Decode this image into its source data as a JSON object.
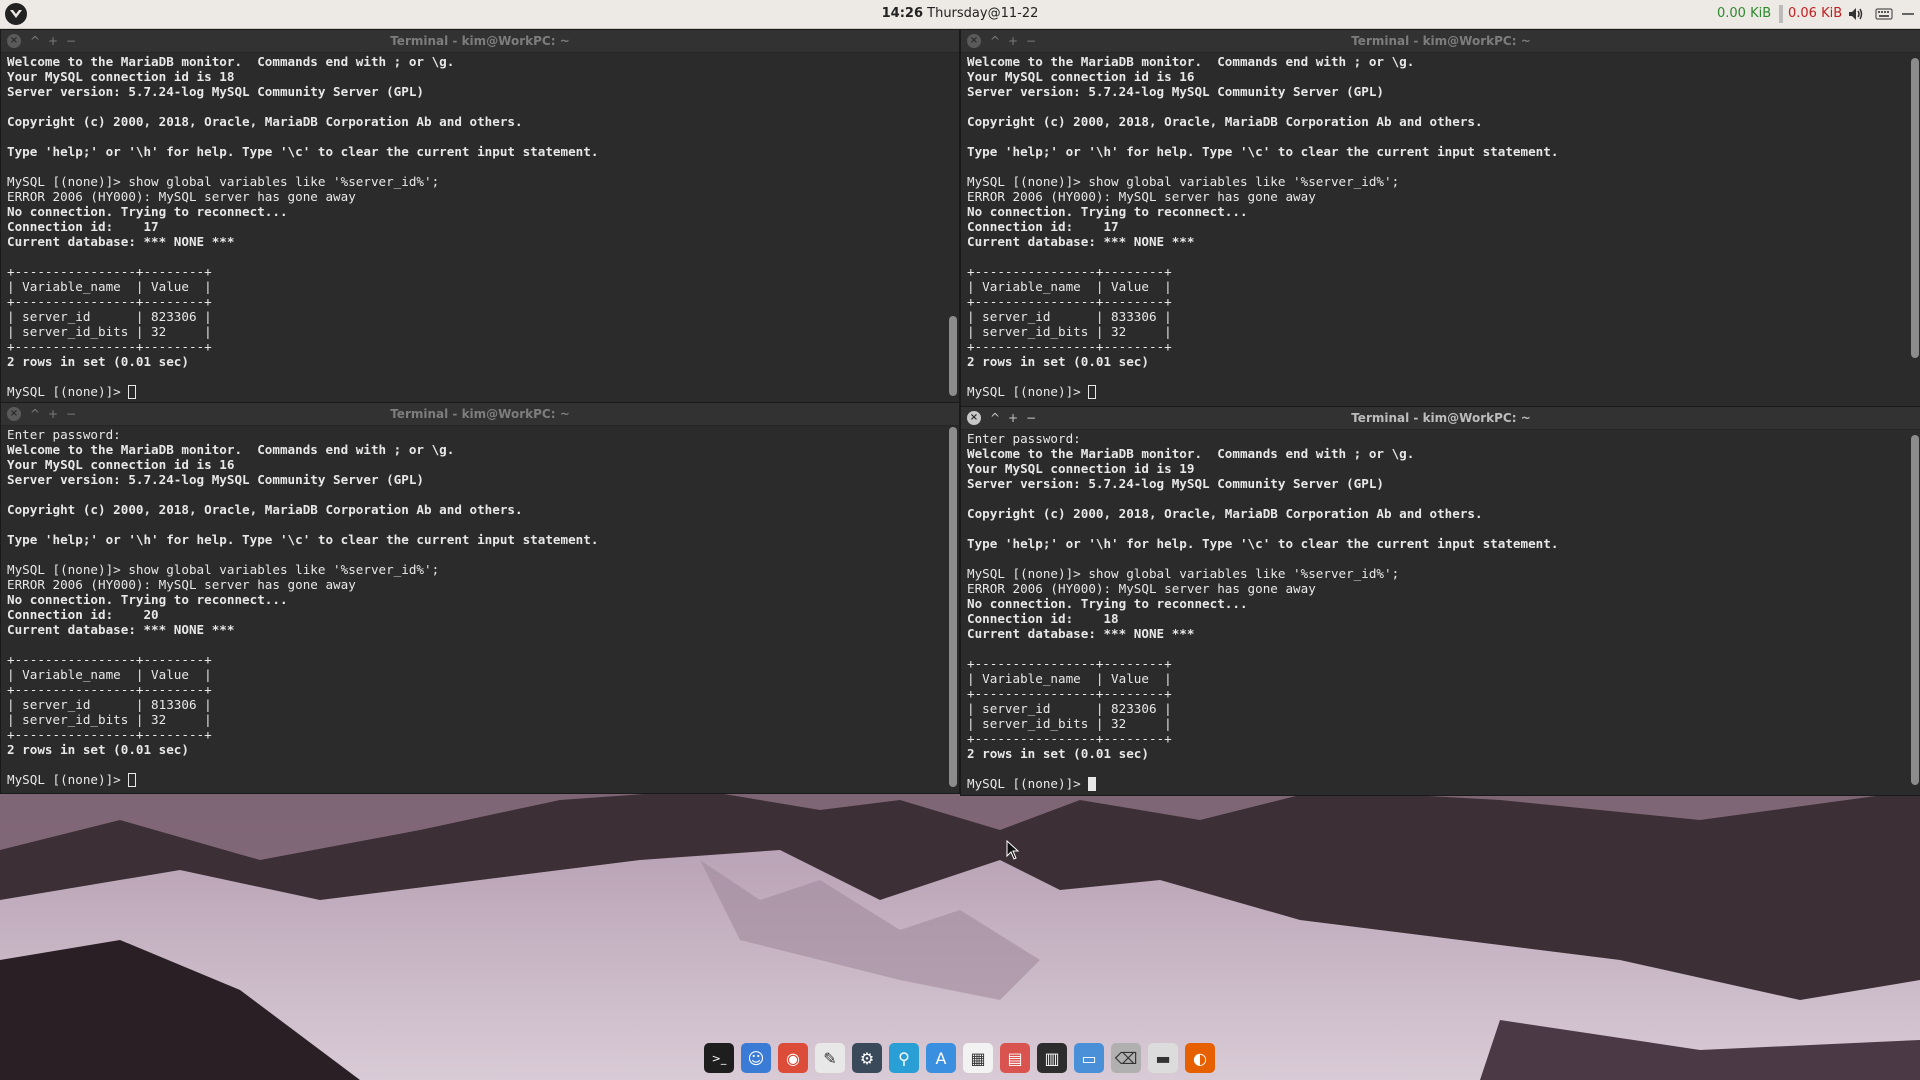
{
  "topbar": {
    "clock_time": "14:26",
    "clock_date": "Thursday@11-22",
    "net_down": "0.00 KiB",
    "net_up": "0.06 KiB",
    "icons": [
      "menu-logo-icon",
      "volume-icon",
      "keyboard-icon"
    ]
  },
  "terminals": [
    {
      "title": "Terminal - kim@WorkPC: ~",
      "active": false,
      "lines": [
        {
          "t": "Welcome to the MariaDB monitor.  Commands end with ; or \\g.",
          "b": true
        },
        {
          "t": "Your MySQL connection id is 18",
          "b": true
        },
        {
          "t": "Server version: 5.7.24-log MySQL Community Server (GPL)",
          "b": true
        },
        {
          "t": "",
          "b": false
        },
        {
          "t": "Copyright (c) 2000, 2018, Oracle, MariaDB Corporation Ab and others.",
          "b": true
        },
        {
          "t": "",
          "b": false
        },
        {
          "t": "Type 'help;' or '\\h' for help. Type '\\c' to clear the current input statement.",
          "b": true
        },
        {
          "t": "",
          "b": false
        },
        {
          "t": "MySQL [(none)]> show global variables like '%server_id%';",
          "b": false
        },
        {
          "t": "ERROR 2006 (HY000): MySQL server has gone away",
          "b": false
        },
        {
          "t": "No connection. Trying to reconnect...",
          "b": true
        },
        {
          "t": "Connection id:    17",
          "b": true
        },
        {
          "t": "Current database: *** NONE ***",
          "b": true
        },
        {
          "t": "",
          "b": false
        },
        {
          "t": "+----------------+--------+",
          "b": false
        },
        {
          "t": "| Variable_name  | Value  |",
          "b": false
        },
        {
          "t": "+----------------+--------+",
          "b": false
        },
        {
          "t": "| server_id      | 823306 |",
          "b": false
        },
        {
          "t": "| server_id_bits | 32     |",
          "b": false
        },
        {
          "t": "+----------------+--------+",
          "b": false
        },
        {
          "t": "2 rows in set (0.01 sec)",
          "b": true
        },
        {
          "t": "",
          "b": false
        }
      ],
      "prompt": "MySQL [(none)]> ",
      "cursor": "box"
    },
    {
      "title": "Terminal - kim@WorkPC: ~",
      "active": false,
      "lines": [
        {
          "t": "Welcome to the MariaDB monitor.  Commands end with ; or \\g.",
          "b": true
        },
        {
          "t": "Your MySQL connection id is 16",
          "b": true
        },
        {
          "t": "Server version: 5.7.24-log MySQL Community Server (GPL)",
          "b": true
        },
        {
          "t": "",
          "b": false
        },
        {
          "t": "Copyright (c) 2000, 2018, Oracle, MariaDB Corporation Ab and others.",
          "b": true
        },
        {
          "t": "",
          "b": false
        },
        {
          "t": "Type 'help;' or '\\h' for help. Type '\\c' to clear the current input statement.",
          "b": true
        },
        {
          "t": "",
          "b": false
        },
        {
          "t": "MySQL [(none)]> show global variables like '%server_id%';",
          "b": false
        },
        {
          "t": "ERROR 2006 (HY000): MySQL server has gone away",
          "b": false
        },
        {
          "t": "No connection. Trying to reconnect...",
          "b": true
        },
        {
          "t": "Connection id:    17",
          "b": true
        },
        {
          "t": "Current database: *** NONE ***",
          "b": true
        },
        {
          "t": "",
          "b": false
        },
        {
          "t": "+----------------+--------+",
          "b": false
        },
        {
          "t": "| Variable_name  | Value  |",
          "b": false
        },
        {
          "t": "+----------------+--------+",
          "b": false
        },
        {
          "t": "| server_id      | 833306 |",
          "b": false
        },
        {
          "t": "| server_id_bits | 32     |",
          "b": false
        },
        {
          "t": "+----------------+--------+",
          "b": false
        },
        {
          "t": "2 rows in set (0.01 sec)",
          "b": true
        },
        {
          "t": "",
          "b": false
        }
      ],
      "prompt": "MySQL [(none)]> ",
      "cursor": "box"
    },
    {
      "title": "Terminal - kim@WorkPC: ~",
      "active": false,
      "lines": [
        {
          "t": "Enter password:",
          "b": false
        },
        {
          "t": "Welcome to the MariaDB monitor.  Commands end with ; or \\g.",
          "b": true
        },
        {
          "t": "Your MySQL connection id is 16",
          "b": true
        },
        {
          "t": "Server version: 5.7.24-log MySQL Community Server (GPL)",
          "b": true
        },
        {
          "t": "",
          "b": false
        },
        {
          "t": "Copyright (c) 2000, 2018, Oracle, MariaDB Corporation Ab and others.",
          "b": true
        },
        {
          "t": "",
          "b": false
        },
        {
          "t": "Type 'help;' or '\\h' for help. Type '\\c' to clear the current input statement.",
          "b": true
        },
        {
          "t": "",
          "b": false
        },
        {
          "t": "MySQL [(none)]> show global variables like '%server_id%';",
          "b": false
        },
        {
          "t": "ERROR 2006 (HY000): MySQL server has gone away",
          "b": false
        },
        {
          "t": "No connection. Trying to reconnect...",
          "b": true
        },
        {
          "t": "Connection id:    20",
          "b": true
        },
        {
          "t": "Current database: *** NONE ***",
          "b": true
        },
        {
          "t": "",
          "b": false
        },
        {
          "t": "+----------------+--------+",
          "b": false
        },
        {
          "t": "| Variable_name  | Value  |",
          "b": false
        },
        {
          "t": "+----------------+--------+",
          "b": false
        },
        {
          "t": "| server_id      | 813306 |",
          "b": false
        },
        {
          "t": "| server_id_bits | 32     |",
          "b": false
        },
        {
          "t": "+----------------+--------+",
          "b": false
        },
        {
          "t": "2 rows in set (0.01 sec)",
          "b": true
        },
        {
          "t": "",
          "b": false
        }
      ],
      "prompt": "MySQL [(none)]> ",
      "cursor": "box"
    },
    {
      "title": "Terminal - kim@WorkPC: ~",
      "active": true,
      "lines": [
        {
          "t": "Enter password:",
          "b": false
        },
        {
          "t": "Welcome to the MariaDB monitor.  Commands end with ; or \\g.",
          "b": true
        },
        {
          "t": "Your MySQL connection id is 19",
          "b": true
        },
        {
          "t": "Server version: 5.7.24-log MySQL Community Server (GPL)",
          "b": true
        },
        {
          "t": "",
          "b": false
        },
        {
          "t": "Copyright (c) 2000, 2018, Oracle, MariaDB Corporation Ab and others.",
          "b": true
        },
        {
          "t": "",
          "b": false
        },
        {
          "t": "Type 'help;' or '\\h' for help. Type '\\c' to clear the current input statement.",
          "b": true
        },
        {
          "t": "",
          "b": false
        },
        {
          "t": "MySQL [(none)]> show global variables like '%server_id%';",
          "b": false
        },
        {
          "t": "ERROR 2006 (HY000): MySQL server has gone away",
          "b": false
        },
        {
          "t": "No connection. Trying to reconnect...",
          "b": true
        },
        {
          "t": "Connection id:    18",
          "b": true
        },
        {
          "t": "Current database: *** NONE ***",
          "b": true
        },
        {
          "t": "",
          "b": false
        },
        {
          "t": "+----------------+--------+",
          "b": false
        },
        {
          "t": "| Variable_name  | Value  |",
          "b": false
        },
        {
          "t": "+----------------+--------+",
          "b": false
        },
        {
          "t": "| server_id      | 823306 |",
          "b": false
        },
        {
          "t": "| server_id_bits | 32     |",
          "b": false
        },
        {
          "t": "+----------------+--------+",
          "b": false
        },
        {
          "t": "2 rows in set (0.01 sec)",
          "b": true
        },
        {
          "t": "",
          "b": false
        }
      ],
      "prompt": "MySQL [(none)]> ",
      "cursor": "solid"
    }
  ],
  "window_buttons": {
    "close": "×",
    "up": "^",
    "plus": "+",
    "minus": "−"
  },
  "dock": {
    "items": [
      {
        "name": "terminal-icon",
        "color": "#1e1e1e"
      },
      {
        "name": "finder-icon",
        "color": "#3a7bd5"
      },
      {
        "name": "chrome-icon",
        "color": "#dd4b39"
      },
      {
        "name": "text-editor-icon",
        "color": "#e8e8e8"
      },
      {
        "name": "app-icon",
        "color": "#3a4a5a"
      },
      {
        "name": "search-icon",
        "color": "#2a9fd6"
      },
      {
        "name": "app-store-icon",
        "color": "#3a8fe0"
      },
      {
        "name": "calendar-icon",
        "color": "#f2f2f2"
      },
      {
        "name": "file-manager-icon",
        "color": "#d9534f"
      },
      {
        "name": "monitor-icon",
        "color": "#2d2d2d"
      },
      {
        "name": "desktop-icon",
        "color": "#4a90d9"
      },
      {
        "name": "trash-icon",
        "color": "#b0b0b0"
      },
      {
        "name": "drive-icon",
        "color": "#dcdcdc"
      },
      {
        "name": "firefox-icon",
        "color": "#e66000"
      }
    ]
  }
}
